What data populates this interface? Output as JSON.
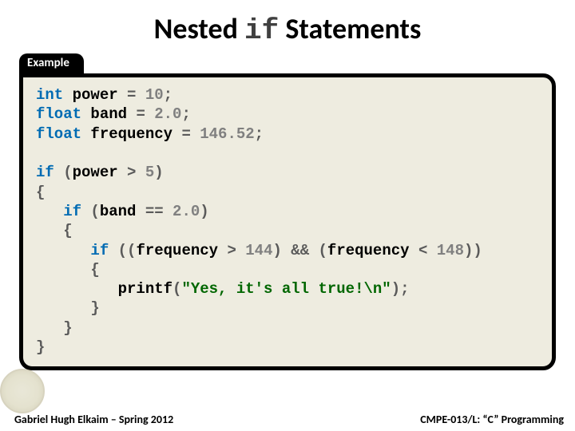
{
  "title": {
    "pre": "Nested ",
    "mono": "if",
    "post": " Statements"
  },
  "panel_label": "Example",
  "code": {
    "l1a": "int",
    "l1b": " power ",
    "l1c": "=",
    "l1d": " 10",
    "l1e": ";",
    "l2a": "float",
    "l2b": " band ",
    "l2c": "=",
    "l2d": " 2.0",
    "l2e": ";",
    "l3a": "float",
    "l3b": " frequency ",
    "l3c": "=",
    "l3d": " 146.52",
    "l3e": ";",
    "l5a": "if",
    "l5b": " (",
    "l5c": "power ",
    "l5d": ">",
    "l5e": " 5",
    "l5f": ")",
    "l6": "{",
    "l7a": "   if",
    "l7b": " (",
    "l7c": "band ",
    "l7d": "==",
    "l7e": " 2.0",
    "l7f": ")",
    "l8": "   {",
    "l9a": "      if",
    "l9b": " ((",
    "l9c": "frequency ",
    "l9d": ">",
    "l9e": " 144",
    "l9f": ") ",
    "l9g": "&&",
    "l9h": " (",
    "l9i": "frequency ",
    "l9j": "<",
    "l9k": " 148",
    "l9l": "))",
    "l10": "      {",
    "l11a": "         printf",
    "l11b": "(",
    "l11c": "\"Yes, it's all true!\\n\"",
    "l11d": ");",
    "l12": "      }",
    "l13": "   }",
    "l14": "}"
  },
  "footer_left": "Gabriel Hugh Elkaim – Spring 2012",
  "footer_right": "CMPE-013/L: “C” Programming"
}
